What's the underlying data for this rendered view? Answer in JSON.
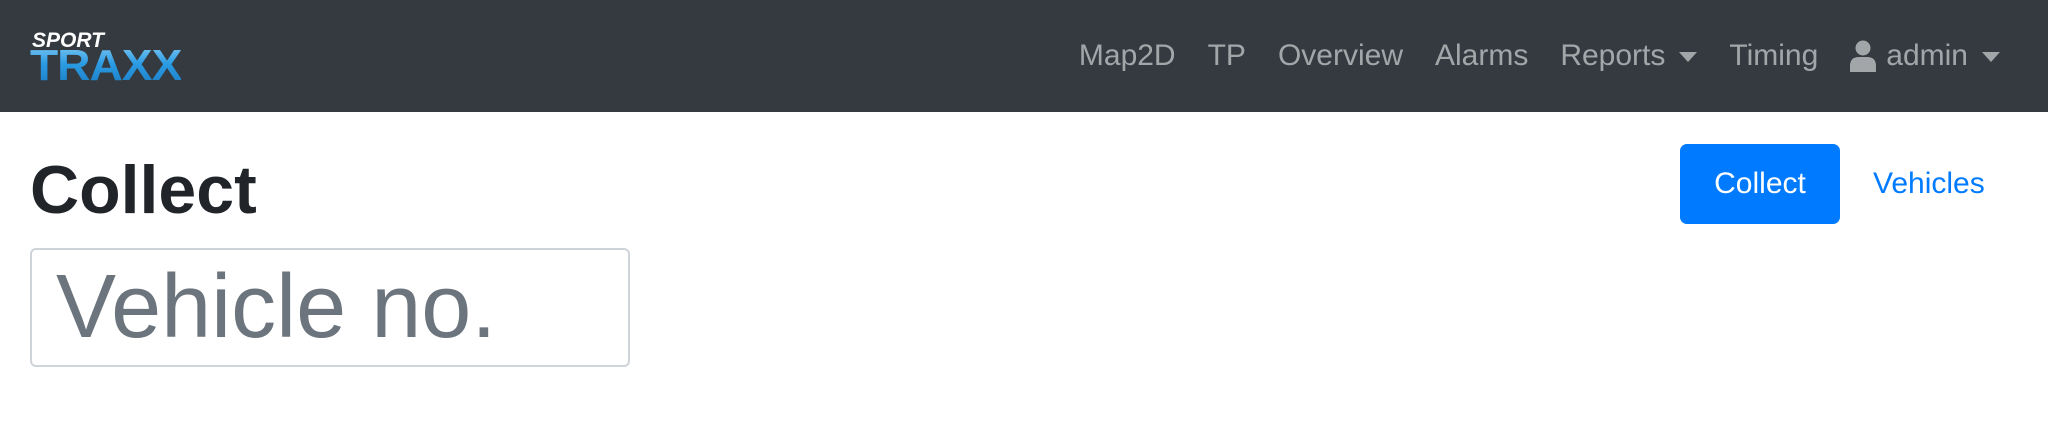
{
  "navbar": {
    "logo": {
      "top_text": "SPORT",
      "main_text": "TRAXX"
    },
    "links": [
      {
        "label": "Map2D"
      },
      {
        "label": "TP"
      },
      {
        "label": "Overview"
      },
      {
        "label": "Alarms"
      },
      {
        "label": "Reports",
        "dropdown": true
      },
      {
        "label": "Timing"
      }
    ],
    "user": {
      "label": "admin",
      "icon": "user-icon",
      "dropdown": true
    }
  },
  "page": {
    "title": "Collect",
    "collect_button": "Collect",
    "vehicles_link": "Vehicles",
    "vehicle_input": {
      "placeholder": "Vehicle no.",
      "value": ""
    }
  },
  "colors": {
    "navbar_bg": "#343a40",
    "primary": "#007bff",
    "nav_text": "rgba(255,255,255,0.55)"
  }
}
